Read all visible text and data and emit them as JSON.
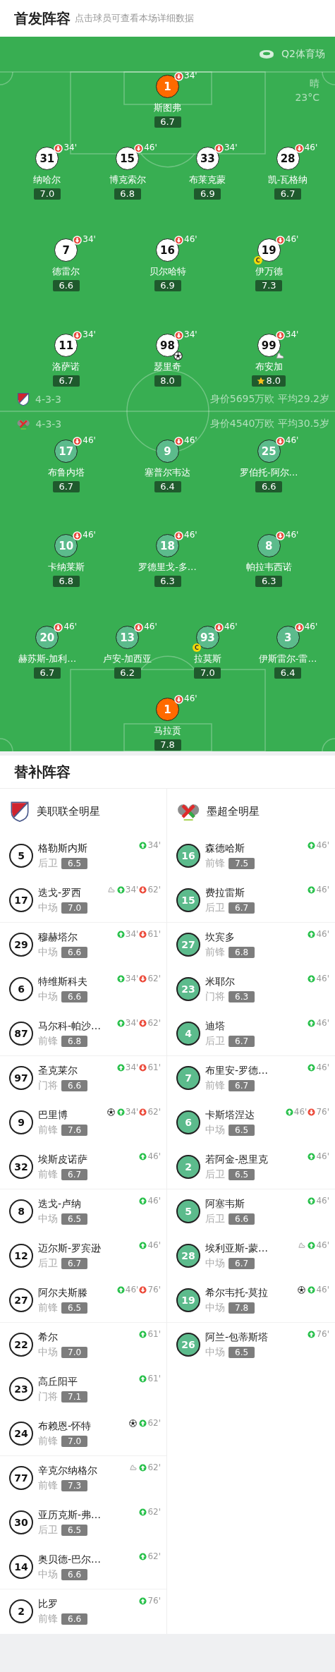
{
  "header": {
    "title": "首发阵容",
    "subtitle": "点击球员可查看本场详细数据"
  },
  "pitch": {
    "stadium": "Q2体育场",
    "weather": "晴",
    "temperature": "23°C",
    "home": {
      "formation": "4-3-3",
      "value": "身价5695万欧 平均29.2岁",
      "lines": [
        [
          {
            "number": "1",
            "name": "斯图弗",
            "rating": "6.7",
            "goalkeeper": true,
            "out_minute": "34'"
          }
        ],
        [
          {
            "number": "31",
            "name": "纳哈尔",
            "rating": "7.0",
            "goalkeeper": false,
            "out_minute": "34'"
          },
          {
            "number": "15",
            "name": "博克索尔",
            "rating": "6.8",
            "goalkeeper": false,
            "out_minute": "46'"
          },
          {
            "number": "33",
            "name": "布莱克蒙",
            "rating": "6.9",
            "goalkeeper": false,
            "out_minute": "34'"
          },
          {
            "number": "28",
            "name": "凯-瓦格纳",
            "rating": "6.7",
            "goalkeeper": false,
            "out_minute": "46'"
          }
        ],
        [
          {
            "number": "7",
            "name": "德雷尔",
            "rating": "6.6",
            "goalkeeper": false,
            "out_minute": "34'"
          },
          {
            "number": "16",
            "name": "贝尔哈特",
            "rating": "6.9",
            "goalkeeper": false,
            "out_minute": "46'"
          },
          {
            "number": "19",
            "name": "伊万德",
            "rating": "7.3",
            "goalkeeper": false,
            "out_minute": "46'",
            "captain": "C"
          }
        ],
        [
          {
            "number": "11",
            "name": "洛萨诺",
            "rating": "6.7",
            "goalkeeper": false,
            "out_minute": "34'"
          },
          {
            "number": "98",
            "name": "瑟里奇",
            "rating": "8.0",
            "goalkeeper": false,
            "out_minute": "34'",
            "events": [
              {
                "kind": "goal"
              }
            ]
          },
          {
            "number": "99",
            "name": "布安加",
            "rating": "8.0",
            "goalkeeper": false,
            "out_minute": "34'",
            "events": [
              {
                "kind": "assist"
              }
            ],
            "mvp": true
          }
        ]
      ]
    },
    "away": {
      "formation": "4-3-3",
      "value": "身价4540万欧 平均30.5岁",
      "lines": [
        [
          {
            "number": "17",
            "name": "布鲁内塔",
            "rating": "6.7",
            "goalkeeper": false,
            "out_minute": "46'"
          },
          {
            "number": "9",
            "name": "塞普尔韦达",
            "rating": "6.4",
            "goalkeeper": false,
            "out_minute": "46'"
          },
          {
            "number": "25",
            "name": "罗伯托-阿尔…",
            "rating": "6.6",
            "goalkeeper": false,
            "out_minute": "46'"
          }
        ],
        [
          {
            "number": "10",
            "name": "卡纳莱斯",
            "rating": "6.8",
            "goalkeeper": false,
            "out_minute": "46'"
          },
          {
            "number": "18",
            "name": "罗德里戈-多…",
            "rating": "6.3",
            "goalkeeper": false,
            "out_minute": "46'"
          },
          {
            "number": "8",
            "name": "帕拉韦西诺",
            "rating": "6.3",
            "goalkeeper": false,
            "out_minute": "46'"
          }
        ],
        [
          {
            "number": "20",
            "name": "赫苏斯-加利…",
            "rating": "6.7",
            "goalkeeper": false,
            "out_minute": "46'"
          },
          {
            "number": "13",
            "name": "卢安-加西亚",
            "rating": "6.2",
            "goalkeeper": false,
            "out_minute": "46'"
          },
          {
            "number": "93",
            "name": "拉莫斯",
            "rating": "7.0",
            "goalkeeper": false,
            "out_minute": "46'",
            "captain": "C"
          },
          {
            "number": "3",
            "name": "伊斯雷尔-雷…",
            "rating": "6.4",
            "goalkeeper": false,
            "out_minute": "46'"
          }
        ],
        [
          {
            "number": "1",
            "name": "马拉贡",
            "rating": "7.8",
            "goalkeeper": true,
            "out_minute": "46'"
          }
        ]
      ]
    }
  },
  "subs": {
    "title": "替补阵容",
    "teams": [
      {
        "name": "美职联全明星",
        "players": [
          {
            "number": "5",
            "name": "格勒斯内斯",
            "position": "后卫",
            "rating": "6.5",
            "events": [
              {
                "kind": "in",
                "minute": "34'"
              }
            ]
          },
          {
            "number": "17",
            "name": "迭戈-罗西",
            "position": "中场",
            "rating": "7.0",
            "events": [
              {
                "kind": "assist"
              },
              {
                "kind": "in",
                "minute": "34'"
              },
              {
                "kind": "out",
                "minute": "62'"
              }
            ]
          },
          {
            "number": "29",
            "name": "穆赫塔尔",
            "position": "中场",
            "rating": "6.6",
            "events": [
              {
                "kind": "in",
                "minute": "34'"
              },
              {
                "kind": "out",
                "minute": "61'"
              }
            ]
          },
          {
            "number": "6",
            "name": "特维斯科夫",
            "position": "中场",
            "rating": "6.6",
            "events": [
              {
                "kind": "in",
                "minute": "34'"
              },
              {
                "kind": "out",
                "minute": "62'"
              }
            ]
          },
          {
            "number": "87",
            "name": "马尔科-帕沙…",
            "position": "前锋",
            "rating": "6.8",
            "events": [
              {
                "kind": "in",
                "minute": "34'"
              },
              {
                "kind": "out",
                "minute": "62'"
              }
            ]
          },
          {
            "number": "97",
            "name": "圣克莱尔",
            "position": "门将",
            "rating": "6.6",
            "events": [
              {
                "kind": "in",
                "minute": "34'"
              },
              {
                "kind": "out",
                "minute": "61'"
              }
            ]
          },
          {
            "number": "9",
            "name": "巴里博",
            "position": "前锋",
            "rating": "7.6",
            "events": [
              {
                "kind": "goal"
              },
              {
                "kind": "in",
                "minute": "34'"
              },
              {
                "kind": "out",
                "minute": "62'"
              }
            ]
          },
          {
            "number": "32",
            "name": "埃斯皮诺萨",
            "position": "前锋",
            "rating": "6.7",
            "events": [
              {
                "kind": "in",
                "minute": "46'"
              }
            ]
          },
          {
            "number": "8",
            "name": "迭戈-卢纳",
            "position": "中场",
            "rating": "6.5",
            "events": [
              {
                "kind": "in",
                "minute": "46'"
              }
            ]
          },
          {
            "number": "12",
            "name": "迈尔斯-罗宾逊",
            "position": "后卫",
            "rating": "6.7",
            "events": [
              {
                "kind": "in",
                "minute": "46'"
              }
            ]
          },
          {
            "number": "27",
            "name": "阿尔夫斯滕",
            "position": "前锋",
            "rating": "6.5",
            "events": [
              {
                "kind": "in",
                "minute": "46'"
              },
              {
                "kind": "out",
                "minute": "76'"
              }
            ]
          },
          {
            "number": "22",
            "name": "希尔",
            "position": "中场",
            "rating": "7.0",
            "events": [
              {
                "kind": "in",
                "minute": "61'"
              }
            ]
          },
          {
            "number": "23",
            "name": "高丘阳平",
            "position": "门将",
            "rating": "7.1",
            "events": [
              {
                "kind": "in",
                "minute": "61'"
              }
            ]
          },
          {
            "number": "24",
            "name": "布赖恩-怀特",
            "position": "前锋",
            "rating": "7.0",
            "events": [
              {
                "kind": "goal"
              },
              {
                "kind": "in",
                "minute": "62'"
              }
            ]
          },
          {
            "number": "77",
            "name": "辛克尔纳格尔",
            "position": "前锋",
            "rating": "7.3",
            "events": [
              {
                "kind": "assist"
              },
              {
                "kind": "in",
                "minute": "62'"
              }
            ]
          },
          {
            "number": "30",
            "name": "亚历克斯-弗…",
            "position": "后卫",
            "rating": "6.5",
            "events": [
              {
                "kind": "in",
                "minute": "62'"
              }
            ]
          },
          {
            "number": "14",
            "name": "奥贝德-巴尔…",
            "position": "中场",
            "rating": "6.6",
            "events": [
              {
                "kind": "in",
                "minute": "62'"
              }
            ]
          },
          {
            "number": "2",
            "name": "比罗",
            "position": "前锋",
            "rating": "6.6",
            "events": [
              {
                "kind": "in",
                "minute": "76'"
              }
            ]
          }
        ]
      },
      {
        "name": "墨超全明星",
        "players": [
          {
            "number": "16",
            "name": "森德哈斯",
            "position": "前锋",
            "rating": "7.5",
            "events": [
              {
                "kind": "in",
                "minute": "46'"
              }
            ]
          },
          {
            "number": "15",
            "name": "费拉雷斯",
            "position": "后卫",
            "rating": "6.7",
            "events": [
              {
                "kind": "in",
                "minute": "46'"
              }
            ]
          },
          {
            "number": "27",
            "name": "坎宾多",
            "position": "前锋",
            "rating": "6.8",
            "events": [
              {
                "kind": "in",
                "minute": "46'"
              }
            ]
          },
          {
            "number": "23",
            "name": "米耶尔",
            "position": "门将",
            "rating": "6.3",
            "events": [
              {
                "kind": "in",
                "minute": "46'"
              }
            ]
          },
          {
            "number": "4",
            "name": "迪塔",
            "position": "后卫",
            "rating": "6.7",
            "events": [
              {
                "kind": "in",
                "minute": "46'"
              }
            ]
          },
          {
            "number": "7",
            "name": "布里安-罗德…",
            "position": "前锋",
            "rating": "6.7",
            "events": [
              {
                "kind": "in",
                "minute": "46'"
              }
            ]
          },
          {
            "number": "6",
            "name": "卡斯塔涅达",
            "position": "中场",
            "rating": "6.5",
            "events": [
              {
                "kind": "in",
                "minute": "46'"
              },
              {
                "kind": "out",
                "minute": "76'"
              }
            ]
          },
          {
            "number": "2",
            "name": "若阿金-恩里克",
            "position": "后卫",
            "rating": "6.5",
            "events": [
              {
                "kind": "in",
                "minute": "46'"
              }
            ]
          },
          {
            "number": "5",
            "name": "阿塞韦斯",
            "position": "后卫",
            "rating": "6.6",
            "events": [
              {
                "kind": "in",
                "minute": "46'"
              }
            ]
          },
          {
            "number": "28",
            "name": "埃利亚斯-蒙…",
            "position": "中场",
            "rating": "6.7",
            "events": [
              {
                "kind": "assist"
              },
              {
                "kind": "in",
                "minute": "46'"
              }
            ]
          },
          {
            "number": "19",
            "name": "希尔韦托-莫拉",
            "position": "中场",
            "rating": "7.8",
            "events": [
              {
                "kind": "goal"
              },
              {
                "kind": "in",
                "minute": "46'"
              }
            ]
          },
          {
            "number": "26",
            "name": "阿兰-包蒂斯塔",
            "position": "中场",
            "rating": "6.5",
            "events": [
              {
                "kind": "in",
                "minute": "76'"
              }
            ]
          }
        ]
      }
    ]
  }
}
